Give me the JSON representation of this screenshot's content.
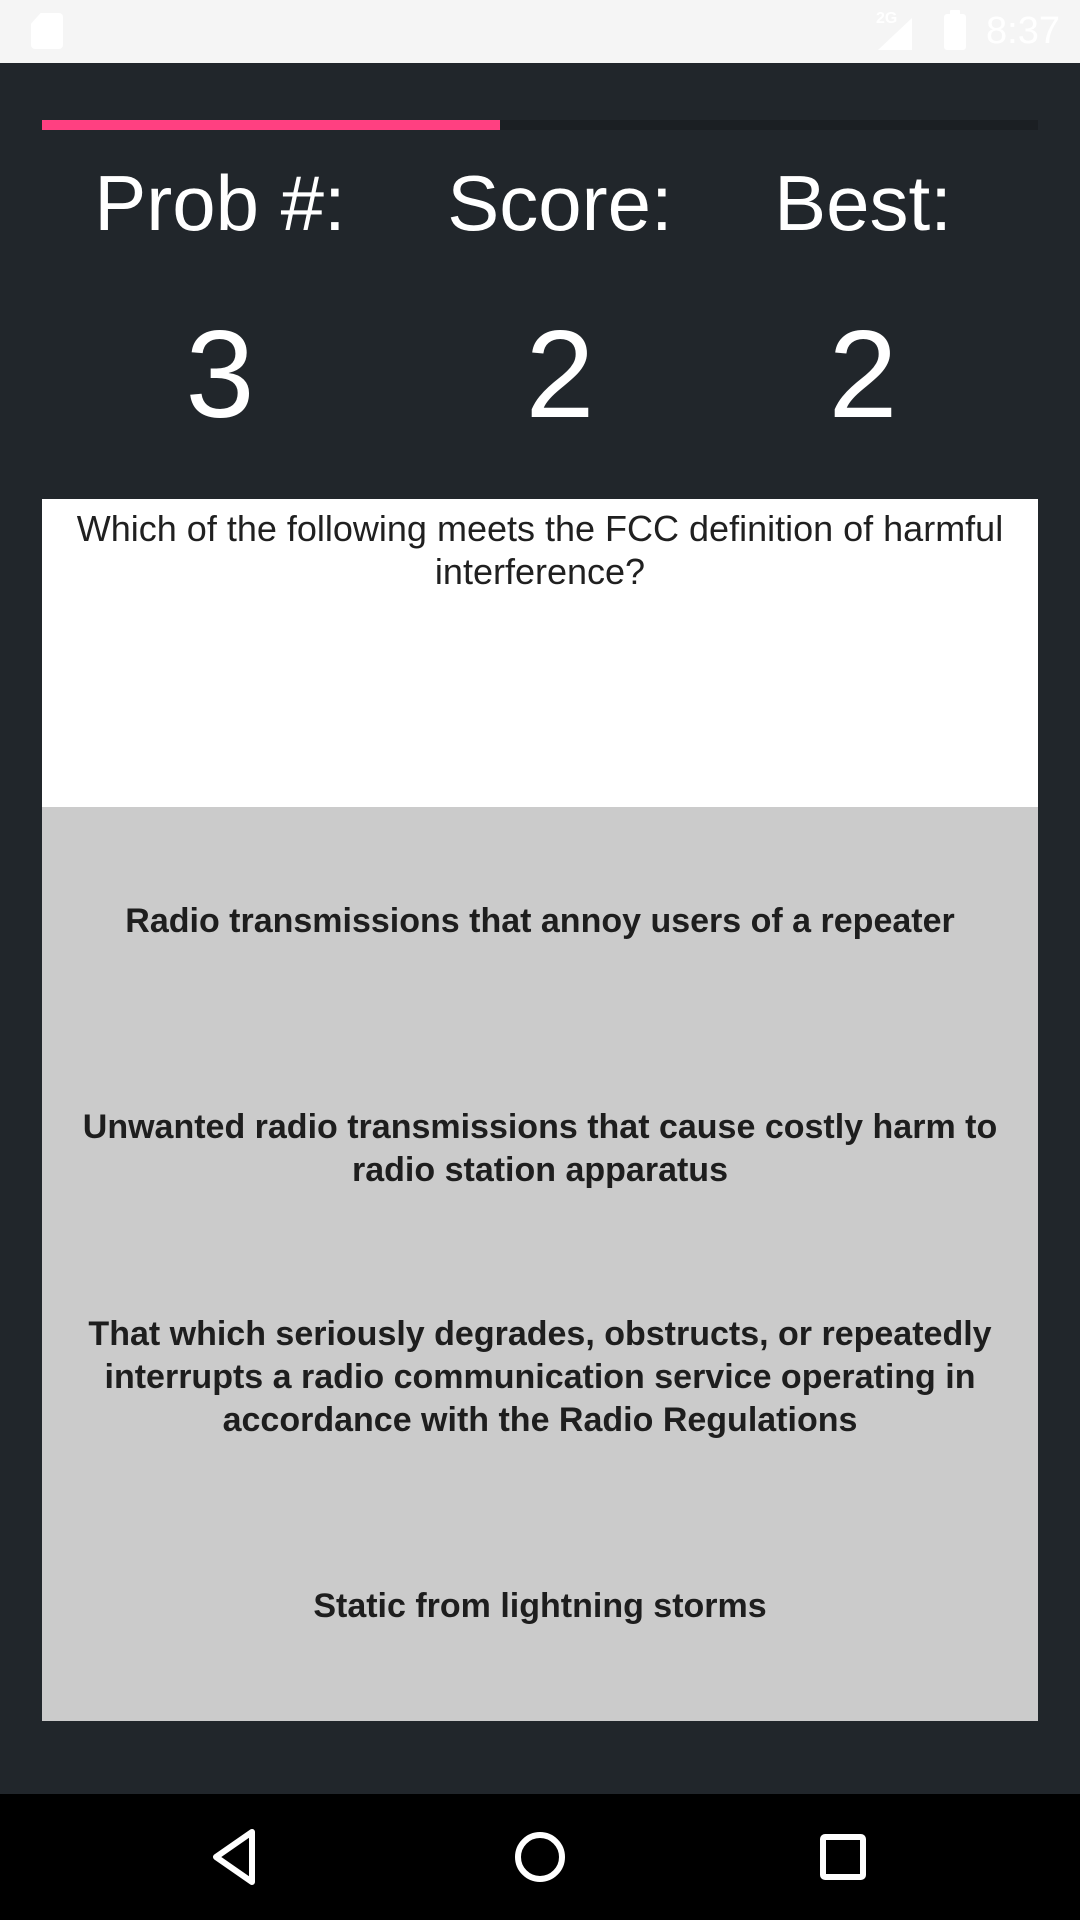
{
  "status_bar": {
    "network_label": "2G",
    "time": "8:37",
    "icons": [
      "sd-card-icon",
      "signal-icon",
      "battery-icon"
    ]
  },
  "progress": {
    "fraction": 0.46,
    "color": "#ff4081"
  },
  "stats": {
    "problem_label": "Prob #:",
    "problem_value": "3",
    "score_label": "Score:",
    "score_value": "2",
    "best_label": "Best:",
    "best_value": "2"
  },
  "question": {
    "text": "Which of the following meets the FCC definition of harmful interference?"
  },
  "answers": [
    {
      "text": "Radio transmissions that annoy users of a repeater"
    },
    {
      "text": "Unwanted radio transmissions that cause costly harm to radio station apparatus"
    },
    {
      "text": "That which seriously degrades, obstructs, or repeatedly interrupts a radio communication service operating in accordance with the Radio Regulations"
    },
    {
      "text": "Static from lightning storms"
    }
  ],
  "nav_bar": {
    "icons": [
      "back-icon",
      "home-icon",
      "recents-icon"
    ]
  },
  "colors": {
    "background": "#21262b",
    "answer_background": "#cbcbcb",
    "question_background": "#ffffff",
    "accent": "#ff4081"
  }
}
